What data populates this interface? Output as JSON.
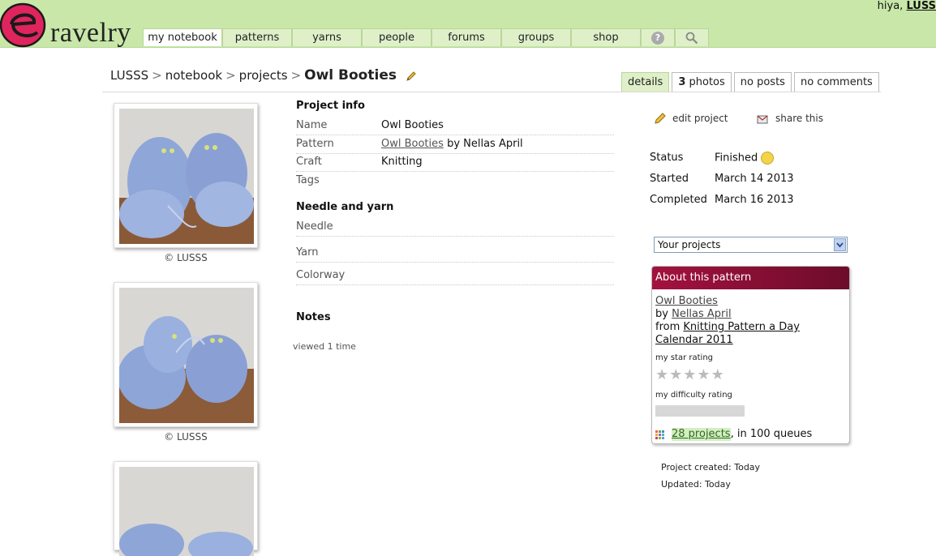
{
  "header": {
    "logo_text": "ravelry",
    "greeting": "hiya,",
    "username": "LUSS",
    "nav": [
      {
        "label": "my notebook",
        "active": true
      },
      {
        "label": "patterns"
      },
      {
        "label": "yarns"
      },
      {
        "label": "people"
      },
      {
        "label": "forums"
      },
      {
        "label": "groups"
      },
      {
        "label": "shop"
      }
    ],
    "help_icon": "question-icon",
    "search_icon": "search-icon"
  },
  "breadcrumb": {
    "user": "LUSSS",
    "notebook": "notebook",
    "projects": "projects",
    "title": "Owl Booties",
    "sep": ">"
  },
  "tabs": {
    "details": "details",
    "photos_count": "3",
    "photos": "photos",
    "posts": "no posts",
    "comments": "no comments"
  },
  "photos": {
    "caption1": "© LUSSS",
    "caption2": "© LUSSS"
  },
  "project_info": {
    "heading": "Project info",
    "name_label": "Name",
    "name_value": "Owl Booties",
    "pattern_label": "Pattern",
    "pattern_link": "Owl Booties",
    "pattern_by": "by Nellas April",
    "craft_label": "Craft",
    "craft_value": "Knitting",
    "tags_label": "Tags"
  },
  "needle_yarn": {
    "heading": "Needle and yarn",
    "needle_label": "Needle",
    "yarn_label": "Yarn",
    "colorway_label": "Colorway"
  },
  "notes": {
    "heading": "Notes",
    "viewed": "viewed 1 time"
  },
  "actions": {
    "edit": "edit project",
    "share": "share this"
  },
  "status": {
    "status_label": "Status",
    "status_value": "Finished",
    "started_label": "Started",
    "started_value": "March 14 2013",
    "completed_label": "Completed",
    "completed_value": "March 16 2013"
  },
  "select": {
    "value": "Your projects"
  },
  "pattern_card": {
    "header": "About this pattern",
    "pattern_name": "Owl Booties",
    "by": "by",
    "designer": "Nellas April",
    "from": "from",
    "source_line1": "Knitting Pattern a Day",
    "source_line2": "Calendar 2011",
    "star_label": "my star rating",
    "star_rating": 0,
    "difficulty_label": "my difficulty rating",
    "projects_link": "28 projects",
    "queues_text": ", in 100 queues"
  },
  "meta": {
    "created": "Project created: Today",
    "updated": "Updated: Today"
  },
  "colors": {
    "header_bg": "#c8e7a8",
    "card_header": "#a3123e",
    "accent": "#dff0c9"
  }
}
